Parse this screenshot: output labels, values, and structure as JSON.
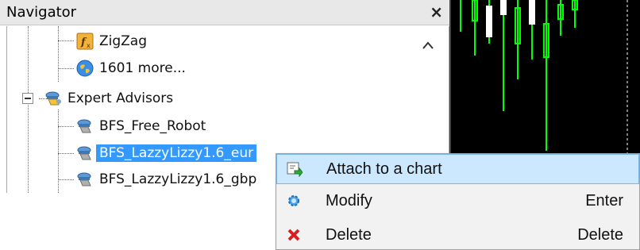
{
  "navigator": {
    "title": "Navigator",
    "close_glyph": "×",
    "scroll_up_glyph": "^",
    "items": [
      {
        "label": "ZigZag",
        "icon": "indicator-function-icon"
      },
      {
        "label": "1601 more...",
        "icon": "globe-icon"
      },
      {
        "label": "Expert Advisors",
        "icon": "expert-advisor-folder-icon",
        "expanded": true
      },
      {
        "label": "BFS_Free_Robot",
        "icon": "expert-advisor-icon"
      },
      {
        "label": "BFS_LazzyLizzy1.6_eur",
        "icon": "expert-advisor-icon",
        "selected": true
      },
      {
        "label": "BFS_LazzyLizzy1.6_gbp",
        "icon": "expert-advisor-icon"
      }
    ]
  },
  "context_menu": {
    "items": [
      {
        "label": "Attach to a chart",
        "shortcut": "",
        "icon": "attach-chart-icon",
        "highlighted": true
      },
      {
        "label": "Modify",
        "shortcut": "Enter",
        "icon": "gear-icon"
      },
      {
        "label": "Delete",
        "shortcut": "Delete",
        "icon": "delete-x-icon"
      }
    ]
  },
  "colors": {
    "selection": "#3399ff",
    "menu_highlight": "#cce8ff",
    "candle": "#00ff00",
    "chart_bg": "#000000"
  }
}
